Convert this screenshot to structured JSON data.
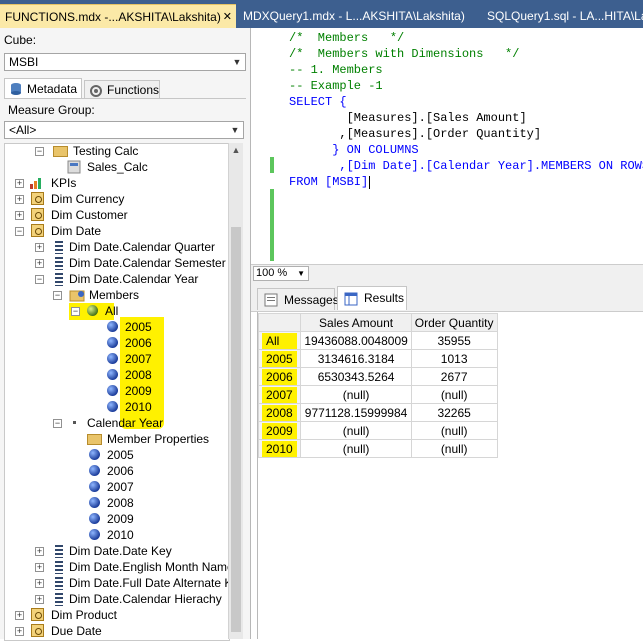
{
  "tabs": [
    {
      "label": "FUNCTIONS.mdx -...AKSHITA\\Lakshita)",
      "close": "✕"
    },
    {
      "label": "MDXQuery1.mdx - L...AKSHITA\\Lakshita)"
    },
    {
      "label": "SQLQuery1.sql - LA...HITA\\Lakshita)"
    }
  ],
  "left": {
    "cube_label": "Cube:",
    "cube_value": "MSBI",
    "metadata_tab": "Metadata",
    "functions_tab": "Functions",
    "measure_group_label": "Measure Group:",
    "measure_group_value": "<All>"
  },
  "tree": [
    {
      "label": "Testing Calc",
      "icon": "folder-icon",
      "expander": "−"
    },
    {
      "label": "Sales_Calc",
      "icon": "calc-icon"
    },
    {
      "label": "KPIs",
      "icon": "kpi-icon",
      "expander": "+"
    },
    {
      "label": "Dim Currency",
      "icon": "dimension-icon",
      "expander": "+"
    },
    {
      "label": "Dim Customer",
      "icon": "dimension-icon",
      "expander": "+"
    },
    {
      "label": "Dim Date",
      "icon": "dimension-icon",
      "expander": "−"
    },
    {
      "label": "Dim Date.Calendar Quarter",
      "icon": "hierarchy-icon",
      "expander": "+"
    },
    {
      "label": "Dim Date.Calendar Semester",
      "icon": "hierarchy-icon",
      "expander": "+"
    },
    {
      "label": "Dim Date.Calendar Year",
      "icon": "hierarchy-icon",
      "expander": "−"
    },
    {
      "label": "Members",
      "icon": "members-icon",
      "expander": "−"
    },
    {
      "label": "All",
      "icon": "member-all-icon",
      "expander": "−"
    },
    {
      "label": "2005",
      "icon": "member-icon"
    },
    {
      "label": "2006",
      "icon": "member-icon"
    },
    {
      "label": "2007",
      "icon": "member-icon"
    },
    {
      "label": "2008",
      "icon": "member-icon"
    },
    {
      "label": "2009",
      "icon": "member-icon"
    },
    {
      "label": "2010",
      "icon": "member-icon"
    },
    {
      "label": "Calendar Year",
      "icon": "level-icon",
      "expander": "−"
    },
    {
      "label": "Member Properties",
      "icon": "folder-icon"
    },
    {
      "label": "2005",
      "icon": "member-icon"
    },
    {
      "label": "2006",
      "icon": "member-icon"
    },
    {
      "label": "2007",
      "icon": "member-icon"
    },
    {
      "label": "2008",
      "icon": "member-icon"
    },
    {
      "label": "2009",
      "icon": "member-icon"
    },
    {
      "label": "2010",
      "icon": "member-icon"
    },
    {
      "label": "Dim Date.Date Key",
      "icon": "hierarchy-icon",
      "expander": "+"
    },
    {
      "label": "Dim Date.English Month Name",
      "icon": "hierarchy-icon",
      "expander": "+"
    },
    {
      "label": "Dim Date.Full Date Alternate Key",
      "icon": "hierarchy-icon",
      "expander": "+"
    },
    {
      "label": "Dim Date.Calendar Hierachy",
      "icon": "hierarchy-icon",
      "expander": "+"
    },
    {
      "label": "Dim Product",
      "icon": "dimension-icon",
      "expander": "+"
    },
    {
      "label": "Due Date",
      "icon": "dimension-icon",
      "expander": "+"
    }
  ],
  "code_lines": [
    "/*  Members   */",
    "/*  Members with Dimensions   */",
    "-- 1. Members",
    "-- Example -1",
    "SELECT {",
    "        [Measures].[Sales Amount]",
    "       ,[Measures].[Order Quantity]",
    "      } ON COLUMNS",
    "       ,[Dim Date].[Calendar Year].MEMBERS ON ROWS",
    "FROM [MSBI]"
  ],
  "zoom": "100 %",
  "results": {
    "messages_tab": "Messages",
    "results_tab": "Results",
    "columns": [
      "Sales Amount",
      "Order Quantity"
    ],
    "rows": [
      {
        "label": "All",
        "sales": "19436088.0048009",
        "qty": "35955"
      },
      {
        "label": "2005",
        "sales": "3134616.3184",
        "qty": "1013"
      },
      {
        "label": "2006",
        "sales": "6530343.5264",
        "qty": "2677"
      },
      {
        "label": "2007",
        "sales": "(null)",
        "qty": "(null)"
      },
      {
        "label": "2008",
        "sales": "9771128.15999984",
        "qty": "32265"
      },
      {
        "label": "2009",
        "sales": "(null)",
        "qty": "(null)"
      },
      {
        "label": "2010",
        "sales": "(null)",
        "qty": "(null)"
      }
    ]
  },
  "colors": {
    "tab_strip": "#3d5f8f",
    "active_tab": "#fbe9a7",
    "highlight": "#fff100",
    "keyword": "#0000ff",
    "comment": "#008000"
  }
}
